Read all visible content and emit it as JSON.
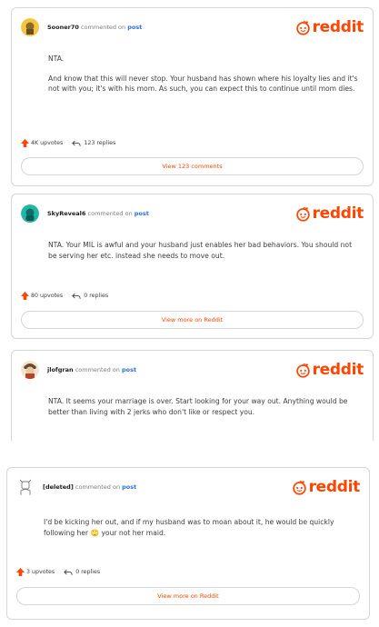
{
  "brand_word": "reddit",
  "accent_color": "#ff4500",
  "comments": [
    {
      "user": "Sooner70",
      "commented_on": "commented on",
      "post_link": "post",
      "avatar_icon": "snoo-avatar-yellow",
      "paragraphs": [
        "NTA.",
        "And know that this will never stop. Your husband has shown where his loyalty lies and it's not with you; it's with his mom. As such, you can expect this to continue until mom dies."
      ],
      "upvotes": "4K upvotes",
      "replies": "123 replies",
      "cta": "View 123 comments"
    },
    {
      "user": "SkyReveal6",
      "commented_on": "commented on",
      "post_link": "post",
      "avatar_icon": "snoo-avatar-teal",
      "paragraphs": [
        "NTA. Your MIL is awful and your husband just enables her bad behaviors. You should not be serving her etc. instead she needs to move out."
      ],
      "upvotes": "80 upvotes",
      "replies": "0 replies",
      "cta": "View more on Reddit"
    },
    {
      "user": "jlofgran",
      "commented_on": "commented on",
      "post_link": "post",
      "avatar_icon": "snoo-avatar-character",
      "paragraphs": [
        "NTA. It seems your marriage is over. Start looking for your way out. Anything would be better than living with 2 jerks who don't like or respect you."
      ]
    },
    {
      "user": "[deleted]",
      "commented_on": "commented on",
      "post_link": "post",
      "avatar_icon": "deleted-user-outline-icon",
      "paragraphs": [
        "I'd be kicking her out, and if my husband was to moan about it, he would be quickly following her 🙄 your not her maid."
      ],
      "upvotes": "3 upvotes",
      "replies": "0 replies",
      "cta": "View more on Reddit"
    }
  ]
}
